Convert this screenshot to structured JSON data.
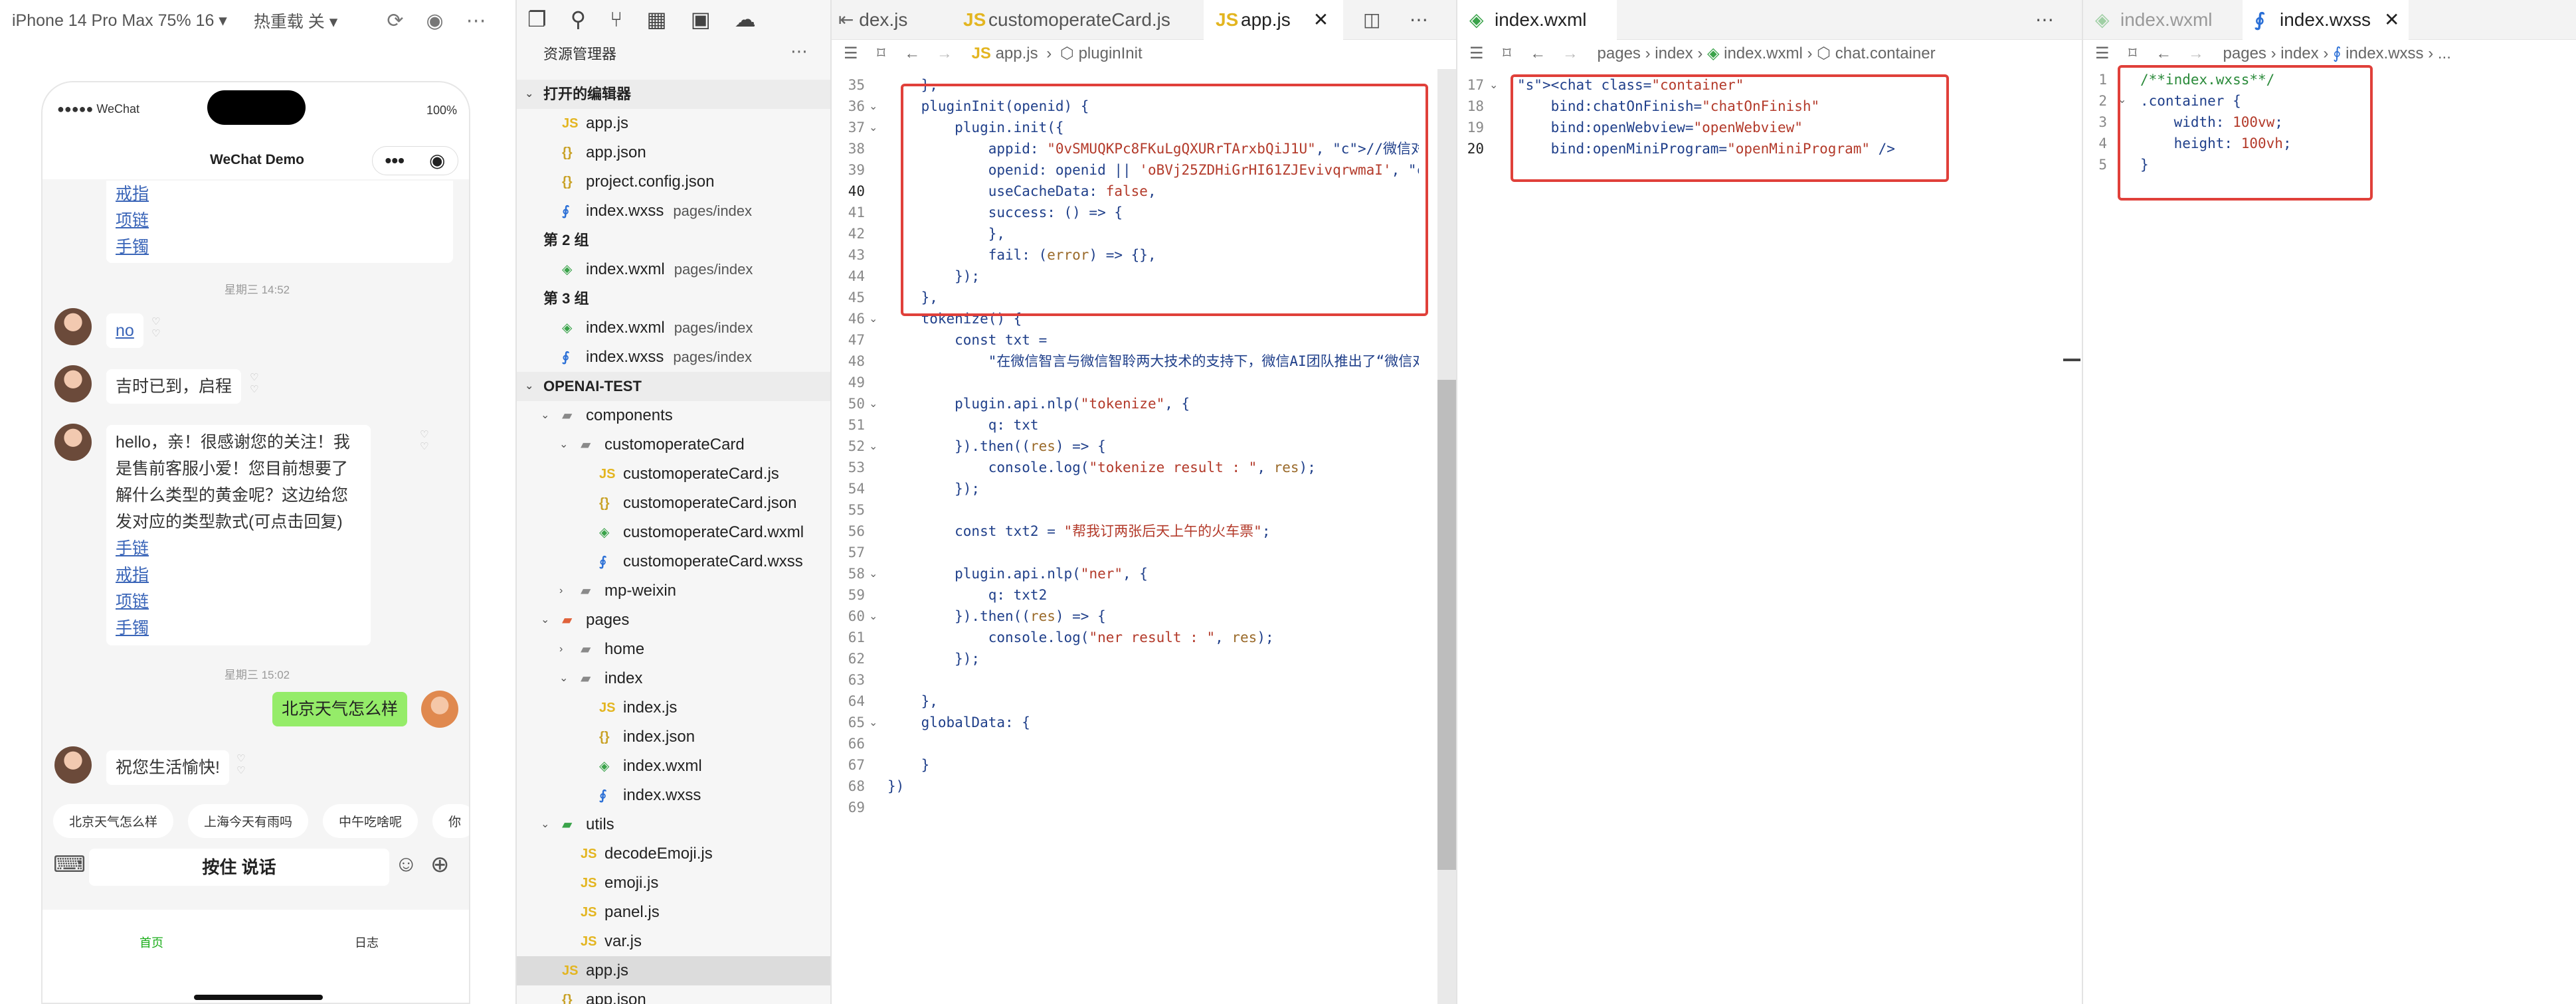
{
  "simulator": {
    "device": "iPhone 14 Pro Max 75% 16 ▾",
    "hotreload": "热重载 关 ▾",
    "status_left": "●●●●● WeChat",
    "status_right": "100%",
    "title": "WeChat Demo",
    "msg1_links": [
      "戒指",
      "项链",
      "手镯"
    ],
    "ts1": "星期三 14:52",
    "msg_no": "no",
    "msg_ji": "吉时已到，启程",
    "msg_hello": "hello，亲！很感谢您的关注！我是售前客服小爱！您目前想要了解什么类型的黄金呢？这边给您发对应的类型款式(可点击回复)",
    "msg_links": [
      "手链",
      "戒指",
      "项链",
      "手镯"
    ],
    "ts2": "星期三 15:02",
    "msg_me": "北京天气怎么样",
    "msg_wish": "祝您生活愉快!",
    "chips": [
      "北京天气怎么样",
      "上海今天有雨吗",
      "中午吃啥呢",
      "你"
    ],
    "voice": "按住 说话",
    "tab1": "首页",
    "tab2": "日志"
  },
  "explorer": {
    "title": "资源管理器",
    "open_editors": "打开的编辑器",
    "group2": "第 2 组",
    "group3": "第 3 组",
    "project": "OPENAI-TEST",
    "items": [
      {
        "name": "app.js",
        "sub": "",
        "indent": 1
      },
      {
        "name": "app.json",
        "sub": "",
        "indent": 1
      },
      {
        "name": "project.config.json",
        "sub": "",
        "indent": 1
      },
      {
        "name": "index.wxss",
        "sub": "pages/index",
        "indent": 1
      },
      {
        "name": "index.wxml",
        "sub": "pages/index",
        "indent": 1
      },
      {
        "name": "index.wxml",
        "sub": "pages/index",
        "indent": 1
      },
      {
        "name": "index.wxss",
        "sub": "pages/index",
        "indent": 1
      },
      {
        "name": "components",
        "sub": "",
        "indent": 1
      },
      {
        "name": "customoperateCard",
        "sub": "",
        "indent": 2
      },
      {
        "name": "customoperateCard.js",
        "sub": "",
        "indent": 3
      },
      {
        "name": "customoperateCard.json",
        "sub": "",
        "indent": 3
      },
      {
        "name": "customoperateCard.wxml",
        "sub": "",
        "indent": 3
      },
      {
        "name": "customoperateCard.wxss",
        "sub": "",
        "indent": 3
      },
      {
        "name": "mp-weixin",
        "sub": "",
        "indent": 2
      },
      {
        "name": "pages",
        "sub": "",
        "indent": 1
      },
      {
        "name": "home",
        "sub": "",
        "indent": 2
      },
      {
        "name": "index",
        "sub": "",
        "indent": 2
      },
      {
        "name": "index.js",
        "sub": "",
        "indent": 3
      },
      {
        "name": "index.json",
        "sub": "",
        "indent": 3
      },
      {
        "name": "index.wxml",
        "sub": "",
        "indent": 3
      },
      {
        "name": "index.wxss",
        "sub": "",
        "indent": 3
      },
      {
        "name": "utils",
        "sub": "",
        "indent": 1
      },
      {
        "name": "decodeEmoji.js",
        "sub": "",
        "indent": 2
      },
      {
        "name": "emoji.js",
        "sub": "",
        "indent": 2
      },
      {
        "name": "panel.js",
        "sub": "",
        "indent": 2
      },
      {
        "name": "var.js",
        "sub": "",
        "indent": 2
      },
      {
        "name": "app.js",
        "sub": "",
        "indent": 1
      },
      {
        "name": "app.json",
        "sub": "",
        "indent": 1
      }
    ]
  },
  "editor1": {
    "tabs": [
      "dex.js",
      "customoperateCard.js",
      "app.js"
    ],
    "crumb1": "app.js",
    "crumb2": "pluginInit",
    "lines": [
      "35",
      "36",
      "37",
      "38",
      "39",
      "40",
      "41",
      "42",
      "43",
      "44",
      "45",
      "46",
      "47",
      "48",
      "49",
      "50",
      "51",
      "52",
      "53",
      "54",
      "55",
      "56",
      "57",
      "58",
      "59",
      "60",
      "61",
      "62",
      "63",
      "64",
      "65",
      "66",
      "67",
      "68",
      "69"
    ],
    "code": [
      "    },",
      "    pluginInit(openid) {",
      "        plugin.init({",
      "            appid: \"0vSMUQKPc8FKuLgQXURrTArxbQiJ1U\", //微信对话开放平台",
      "            openid: openid || 'oBVj25ZDHiGrHI61ZJEvivqrwmaI', // 用户",
      "            useCacheData: false,",
      "            success: () => {",
      "            },",
      "            fail: (error) => {},",
      "        });",
      "    },",
      "    tokenize() {",
      "        const txt =",
      "            \"在微信智言与微信智聆两大技术的支持下，微信AI团队推出了“微信对话",
      "",
      "        plugin.api.nlp(\"tokenize\", {",
      "            q: txt",
      "        }).then((res) => {",
      "            console.log(\"tokenize result : \", res);",
      "        });",
      "",
      "        const txt2 = \"帮我订两张后天上午的火车票\";",
      "",
      "        plugin.api.nlp(\"ner\", {",
      "            q: txt2",
      "        }).then((res) => {",
      "            console.log(\"ner result : \", res);",
      "        });",
      "",
      "    },",
      "    globalData: {",
      "",
      "    }",
      "})",
      ""
    ]
  },
  "editor2": {
    "tab": "index.wxml",
    "crumbs": [
      "pages",
      "index",
      "index.wxml",
      "chat.container"
    ],
    "lines": [
      "17",
      "18",
      "19",
      "20"
    ],
    "code": [
      "<chat class=\"container\"",
      "    bind:chatOnFinish=\"chatOnFinish\"",
      "    bind:openWebview=\"openWebview\"",
      "    bind:openMiniProgram=\"openMiniProgram\" />"
    ]
  },
  "editor3": {
    "tabs": [
      "index.wxml",
      "index.wxss"
    ],
    "crumbs": [
      "pages",
      "index",
      "index.wxss",
      "..."
    ],
    "lines": [
      "1",
      "2",
      "3",
      "4",
      "5"
    ],
    "code": [
      "/**index.wxss**/",
      ".container {",
      "    width: 100vw;",
      "    height: 100vh;",
      "}"
    ]
  }
}
